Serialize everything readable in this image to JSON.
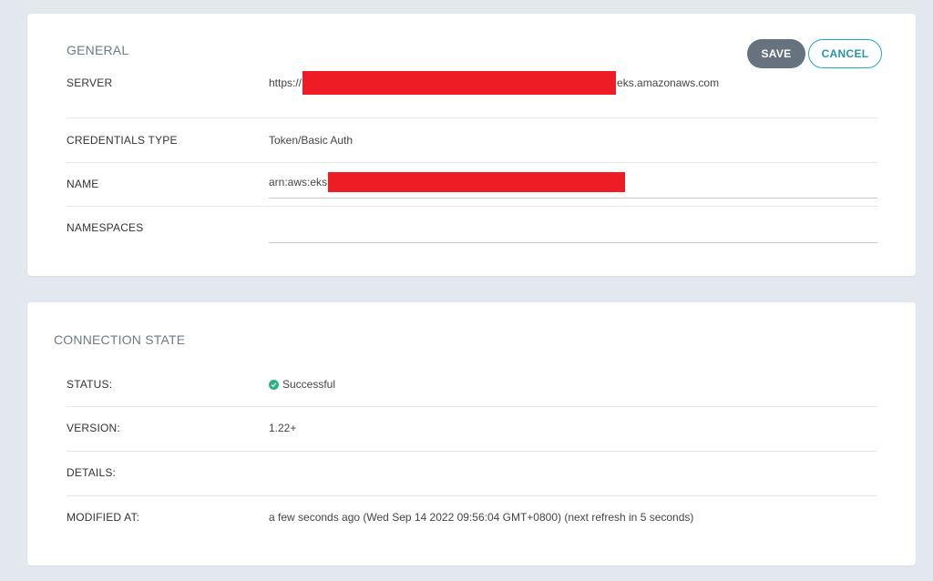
{
  "general": {
    "title": "GENERAL",
    "save_label": "SAVE",
    "cancel_label": "CANCEL",
    "server": {
      "label": "SERVER",
      "prefix": "https://",
      "suffix": "eks.amazonaws.com"
    },
    "credentials_type": {
      "label": "CREDENTIALS TYPE",
      "value": "Token/Basic Auth"
    },
    "name": {
      "label": "NAME",
      "value_prefix": "arn:aws:eks"
    },
    "namespaces": {
      "label": "NAMESPACES",
      "value": ""
    }
  },
  "connection": {
    "title": "CONNECTION STATE",
    "status": {
      "label": "STATUS:",
      "value": "Successful",
      "icon": "check-circle-icon",
      "color": "#28b47c"
    },
    "version": {
      "label": "VERSION:",
      "value": "1.22+"
    },
    "details": {
      "label": "DETAILS:",
      "value": ""
    },
    "modified_at": {
      "label": "MODIFIED AT:",
      "value": "a few seconds ago (Wed Sep 14 2022 09:56:04 GMT+0800) (next refresh in 5 seconds)"
    }
  },
  "colors": {
    "background": "#e3e8ee",
    "save_button": "#66737f",
    "cancel_border": "#2aa7be",
    "redaction": "#ee1c24"
  }
}
